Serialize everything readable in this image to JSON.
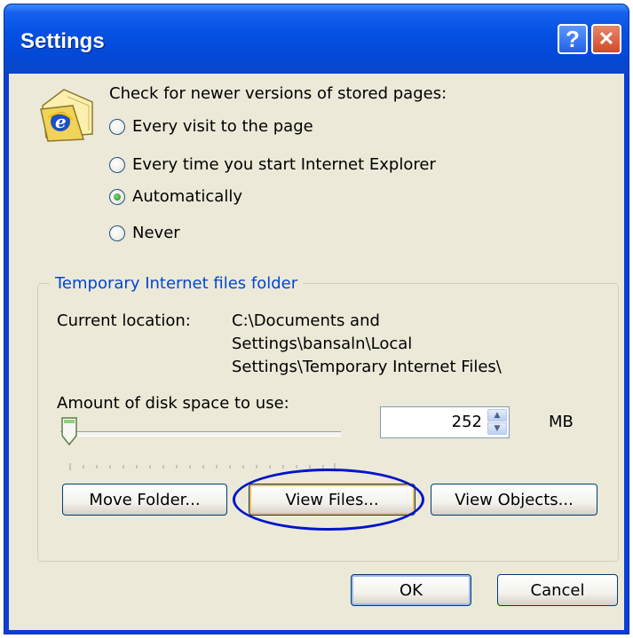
{
  "window": {
    "title": "Settings",
    "help_glyph": "?",
    "close_glyph": "✕"
  },
  "check_group": {
    "label": "Check for newer versions of stored pages:",
    "options": [
      {
        "label": "Every visit to the page",
        "checked": false
      },
      {
        "label": "Every time you start Internet Explorer",
        "checked": false
      },
      {
        "label": "Automatically",
        "checked": true
      },
      {
        "label": "Never",
        "checked": false
      }
    ]
  },
  "temp_files": {
    "group_title": "Temporary Internet files folder",
    "current_location_label": "Current location:",
    "location_lines": [
      "C:\\Documents and",
      "Settings\\bansaln\\Local",
      "Settings\\Temporary Internet Files\\"
    ],
    "disk_space_label": "Amount of disk space to use:",
    "disk_space_value": "252",
    "disk_space_unit": "MB",
    "slider_fraction": 0.0
  },
  "buttons": {
    "move_folder": "Move Folder...",
    "view_files": "View Files...",
    "view_objects": "View Objects...",
    "ok": "OK",
    "cancel": "Cancel"
  },
  "colors": {
    "titlebar": "#0552e3",
    "group_title": "#0046d5",
    "highlight_ellipse": "#0015c8",
    "dialog_bg": "#ece9d8"
  },
  "icons": {
    "folder": "ie-folder-icon",
    "slider_thumb": "slider-thumb-icon"
  }
}
